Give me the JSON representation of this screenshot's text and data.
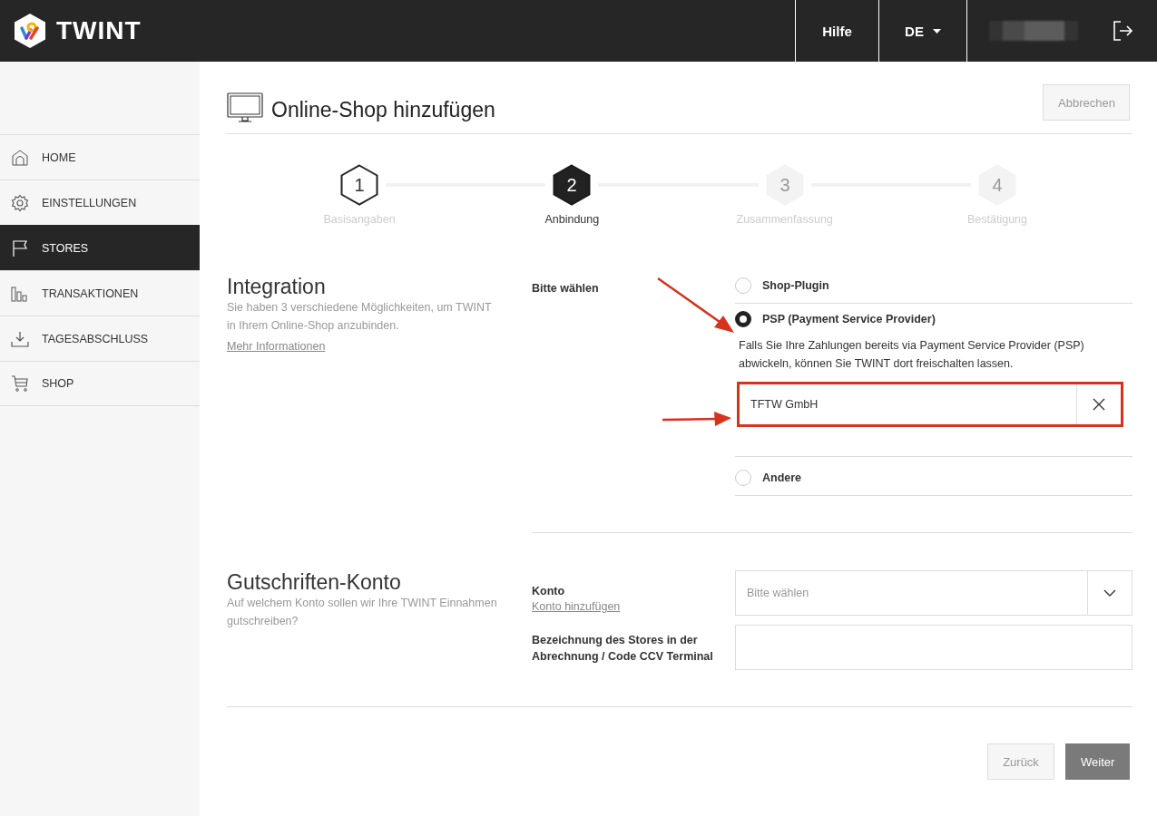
{
  "header": {
    "logo_text": "TWINT",
    "nav": [
      {
        "label": "Hilfe",
        "kind": "link"
      },
      {
        "label": "DE",
        "kind": "dropdown"
      }
    ]
  },
  "sidebar": {
    "items": [
      {
        "label": "HOME",
        "selected": false
      },
      {
        "label": "EINSTELLUNGEN",
        "selected": false
      },
      {
        "label": "STORES",
        "selected": true
      },
      {
        "label": "TRANSAKTIONEN",
        "selected": false
      },
      {
        "label": "TAGESABSCHLUSS",
        "selected": false
      },
      {
        "label": "SHOP",
        "selected": false
      }
    ]
  },
  "page": {
    "title": "Online-Shop hinzufügen",
    "cancel_button": "Abbrechen"
  },
  "steps": [
    {
      "number": "1",
      "label": "Basisangaben",
      "completed": true,
      "current": false
    },
    {
      "number": "2",
      "label": "Anbindung",
      "completed": false,
      "current": true
    },
    {
      "number": "3",
      "label": "Zusammenfassung",
      "completed": false,
      "current": false
    },
    {
      "number": "4",
      "label": "Bestätigung",
      "completed": false,
      "current": false
    }
  ],
  "integration": {
    "title": "Integration",
    "description": "Sie haben 3 verschiedene Möglichkeiten, um TWINT in Ihrem Online-Shop anzubinden.",
    "link": "Mehr Informationen",
    "field_label": "Bitte wählen",
    "options": [
      {
        "label": "Shop-Plugin",
        "selected": false
      },
      {
        "label": "PSP (Payment Service Provider)",
        "selected": true,
        "description": "Falls Sie Ihre Zahlungen bereits via Payment Service Provider (PSP) abwickeln, können Sie TWINT dort freischalten lassen.",
        "input": {
          "value": "TFTW GmbH",
          "highlighted": true
        }
      },
      {
        "label": "Andere",
        "selected": false
      }
    ]
  },
  "account": {
    "title": "Gutschriften-Konto",
    "description": "Auf welchem Konto sollen wir Ihre TWINT Einnahmen gutschreiben?",
    "konto_label": "Konto",
    "konto_link": "Konto hinzufügen",
    "konto_placeholder": "Bitte wählen",
    "store_label": "Bezeichnung des Stores in der Abrechnung / Code CCV Terminal"
  },
  "buttons": [
    {
      "label": "Zurück",
      "kind": "secondary"
    },
    {
      "label": "Weiter",
      "kind": "primary"
    }
  ]
}
